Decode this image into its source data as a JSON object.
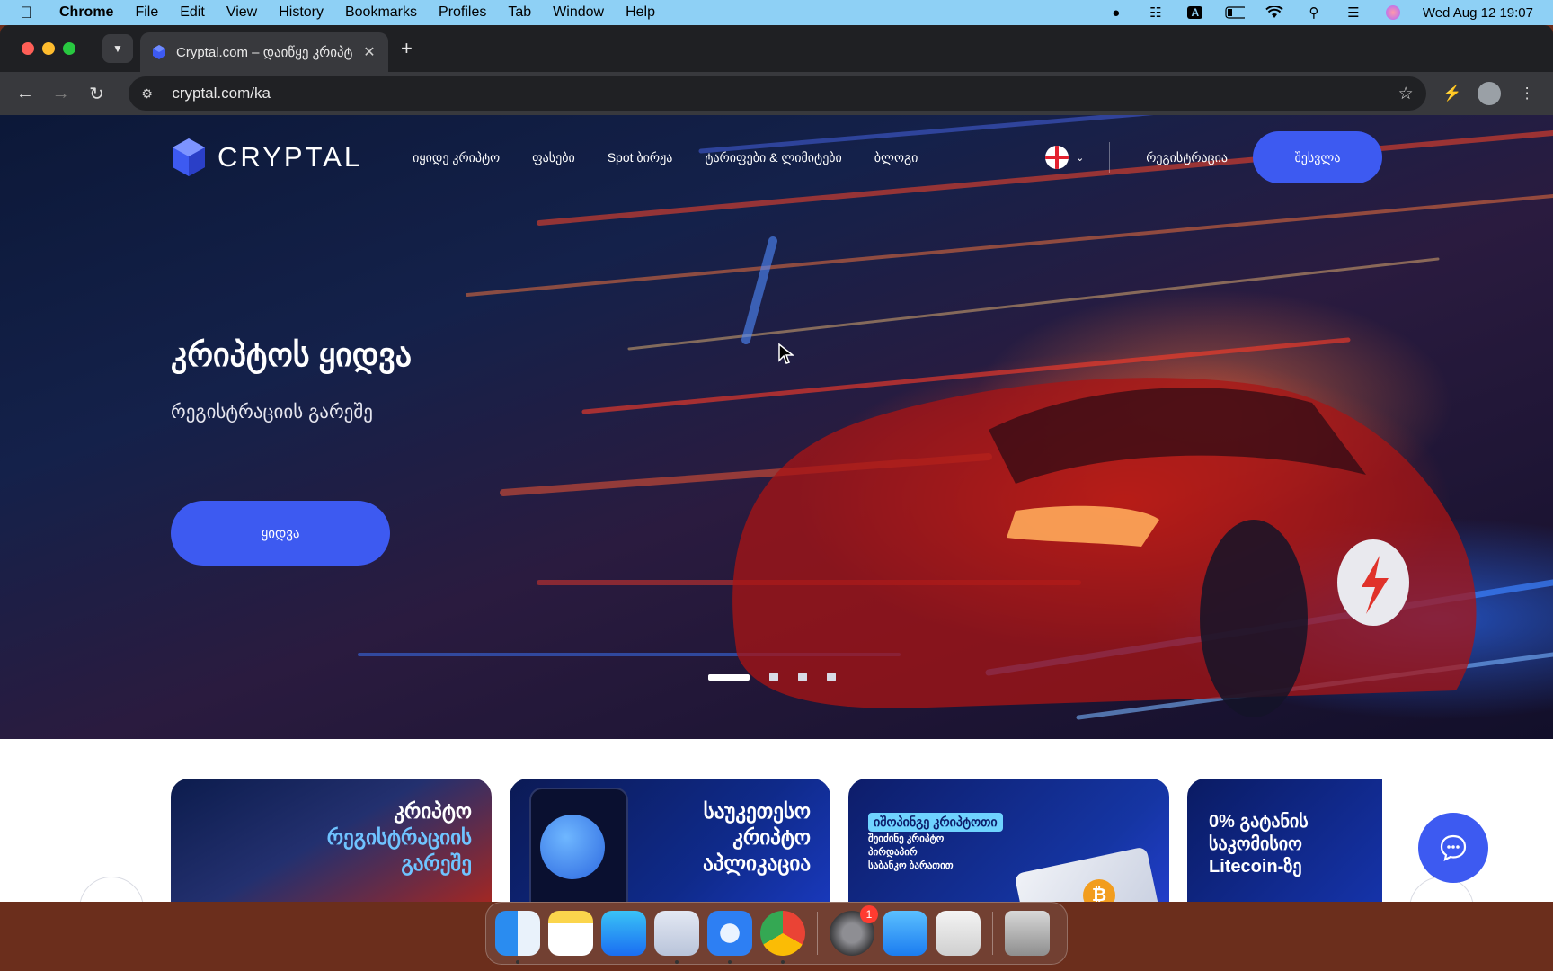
{
  "menubar": {
    "app_name": "Chrome",
    "items": [
      "File",
      "Edit",
      "View",
      "History",
      "Bookmarks",
      "Profiles",
      "Tab",
      "Window",
      "Help"
    ],
    "clock": "Wed Aug 12  19:07",
    "input_indicator": "A"
  },
  "browser": {
    "tab_title": "Cryptal.com – დაიწყე კრიპტ",
    "url": "cryptal.com/ka"
  },
  "site": {
    "logo_text": "CRYPTAL",
    "nav": [
      "იყიდე კრიპტო",
      "ფასები",
      "Spot ბირჟა",
      "ტარიფები & ლიმიტები",
      "ბლოგი"
    ],
    "register": "რეგისტრაცია",
    "login": "შესვლა"
  },
  "hero": {
    "title": "კრიპტოს ყიდვა",
    "subtitle": "რეგისტრაციის გარეშე",
    "cta": "ყიდვა",
    "slide_count": 4,
    "active_slide": 1
  },
  "promos": [
    {
      "lines": "კრიპტო",
      "accent": "რეგისტრაციის\nგარეშე"
    },
    {
      "lines": "საუკეთესო\nკრიპტო\nაპლიკაცია"
    },
    {
      "tag": "იშოპინგე კრიპტოთი",
      "body": "შეიძინე კრიპტო\nპირდაპირ\nსაბანკო ბარათით",
      "coin": "₿"
    },
    {
      "lines": "0% გატანის\nსაკომისიო\nLitecoin-ზე"
    }
  ],
  "dock": {
    "settings_badge": "1"
  },
  "colors": {
    "accent": "#3d5af1",
    "menubar": "#8ed0f5"
  }
}
